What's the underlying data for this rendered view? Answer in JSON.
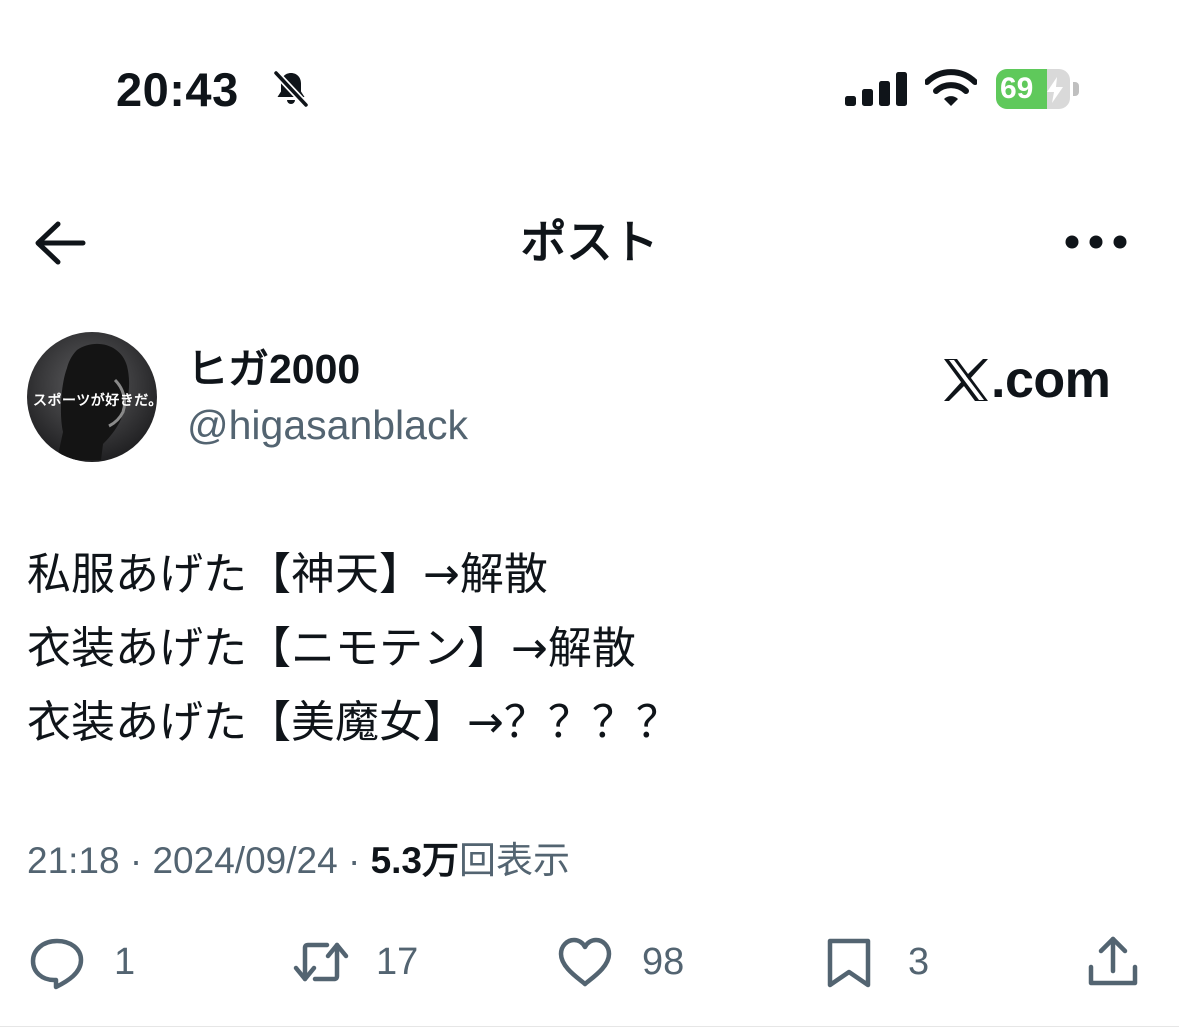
{
  "status_bar": {
    "time": "20:43",
    "battery_percent": "69",
    "battery_level": 0.69,
    "icons": [
      "bell-slash-icon",
      "cellular-signal-icon",
      "wifi-icon",
      "battery-charging-icon"
    ]
  },
  "header": {
    "back_icon": "arrow-left-icon",
    "title": "ポスト",
    "more_icon": "ellipsis-icon"
  },
  "author": {
    "display_name": "ヒガ2000",
    "handle": "@higasanblack",
    "avatar_caption": "スポーツが好きだ。"
  },
  "brand": {
    "logo_icon": "x-logo-icon",
    "domain": ".com"
  },
  "tweet": {
    "lines": [
      "私服あげた【神天】→解散",
      "衣装あげた【ニモテン】→解散",
      "衣装あげた【美魔女】→？？？？"
    ]
  },
  "meta": {
    "time": "21:18",
    "separator": "·",
    "date": "2024/09/24",
    "views_count": "5.3万",
    "views_label": "回表示"
  },
  "actions": {
    "reply": {
      "icon": "reply-bubble-icon",
      "count": "1"
    },
    "repost": {
      "icon": "repost-icon",
      "count": "17"
    },
    "like": {
      "icon": "heart-icon",
      "count": "98"
    },
    "bookmark": {
      "icon": "bookmark-icon",
      "count": "3"
    },
    "share": {
      "icon": "share-icon"
    }
  },
  "colors": {
    "text_primary": "#0f1419",
    "text_secondary": "#536471",
    "battery_green": "#5fc95b",
    "background": "#ffffff"
  }
}
